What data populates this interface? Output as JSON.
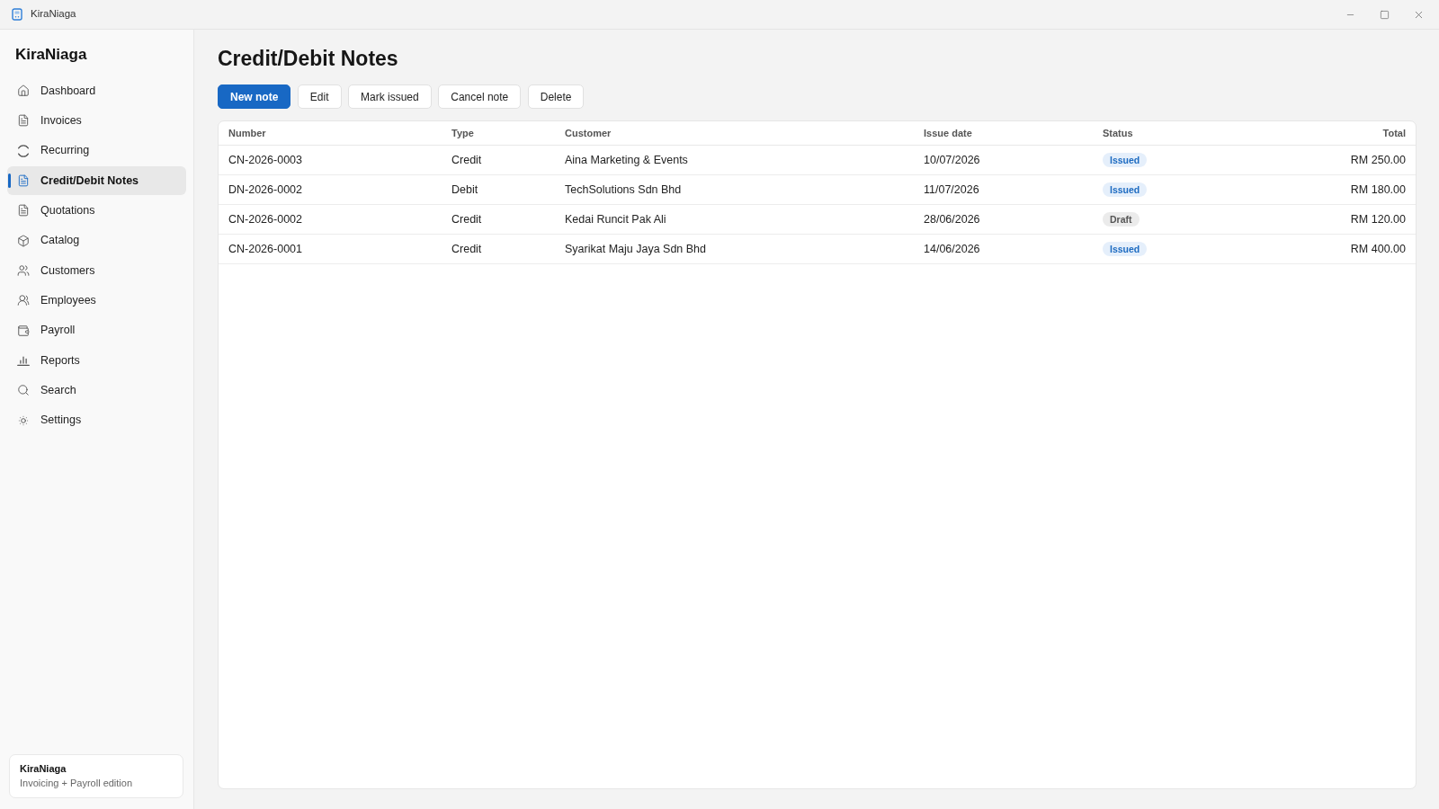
{
  "window": {
    "title": "KiraNiaga"
  },
  "sidebar": {
    "title": "KiraNiaga",
    "items": [
      {
        "label": "Dashboard",
        "selected": false
      },
      {
        "label": "Invoices",
        "selected": false
      },
      {
        "label": "Recurring",
        "selected": false
      },
      {
        "label": "Credit/Debit Notes",
        "selected": true
      },
      {
        "label": "Quotations",
        "selected": false
      },
      {
        "label": "Catalog",
        "selected": false
      },
      {
        "label": "Customers",
        "selected": false
      },
      {
        "label": "Employees",
        "selected": false
      },
      {
        "label": "Payroll",
        "selected": false
      },
      {
        "label": "Reports",
        "selected": false
      },
      {
        "label": "Search",
        "selected": false
      },
      {
        "label": "Settings",
        "selected": false
      }
    ],
    "footer": {
      "title": "KiraNiaga",
      "subtitle": "Invoicing + Payroll edition"
    }
  },
  "page": {
    "title": "Credit/Debit Notes",
    "buttons": [
      {
        "label": "New note",
        "kind": "primary"
      },
      {
        "label": "Edit",
        "kind": "default"
      },
      {
        "label": "Mark issued",
        "kind": "default"
      },
      {
        "label": "Cancel note",
        "kind": "default"
      },
      {
        "label": "Delete",
        "kind": "default"
      }
    ]
  },
  "table": {
    "columns": [
      "Number",
      "Type",
      "Customer",
      "Issue date",
      "Status",
      "Total"
    ],
    "rows": [
      {
        "number": "CN-2026-0003",
        "type": "Credit",
        "customer": "Aina Marketing & Events",
        "issue_date": "10/07/2026",
        "status": {
          "label": "Issued",
          "kind": "issued"
        },
        "total": "RM 250.00"
      },
      {
        "number": "DN-2026-0002",
        "type": "Debit",
        "customer": "TechSolutions Sdn Bhd",
        "issue_date": "11/07/2026",
        "status": {
          "label": "Issued",
          "kind": "issued"
        },
        "total": "RM 180.00"
      },
      {
        "number": "CN-2026-0002",
        "type": "Credit",
        "customer": "Kedai Runcit Pak Ali",
        "issue_date": "28/06/2026",
        "status": {
          "label": "Draft",
          "kind": "draft"
        },
        "total": "RM 120.00"
      },
      {
        "number": "CN-2026-0001",
        "type": "Credit",
        "customer": "Syarikat Maju Jaya Sdn Bhd",
        "issue_date": "14/06/2026",
        "status": {
          "label": "Issued",
          "kind": "issued"
        },
        "total": "RM 400.00"
      }
    ]
  }
}
